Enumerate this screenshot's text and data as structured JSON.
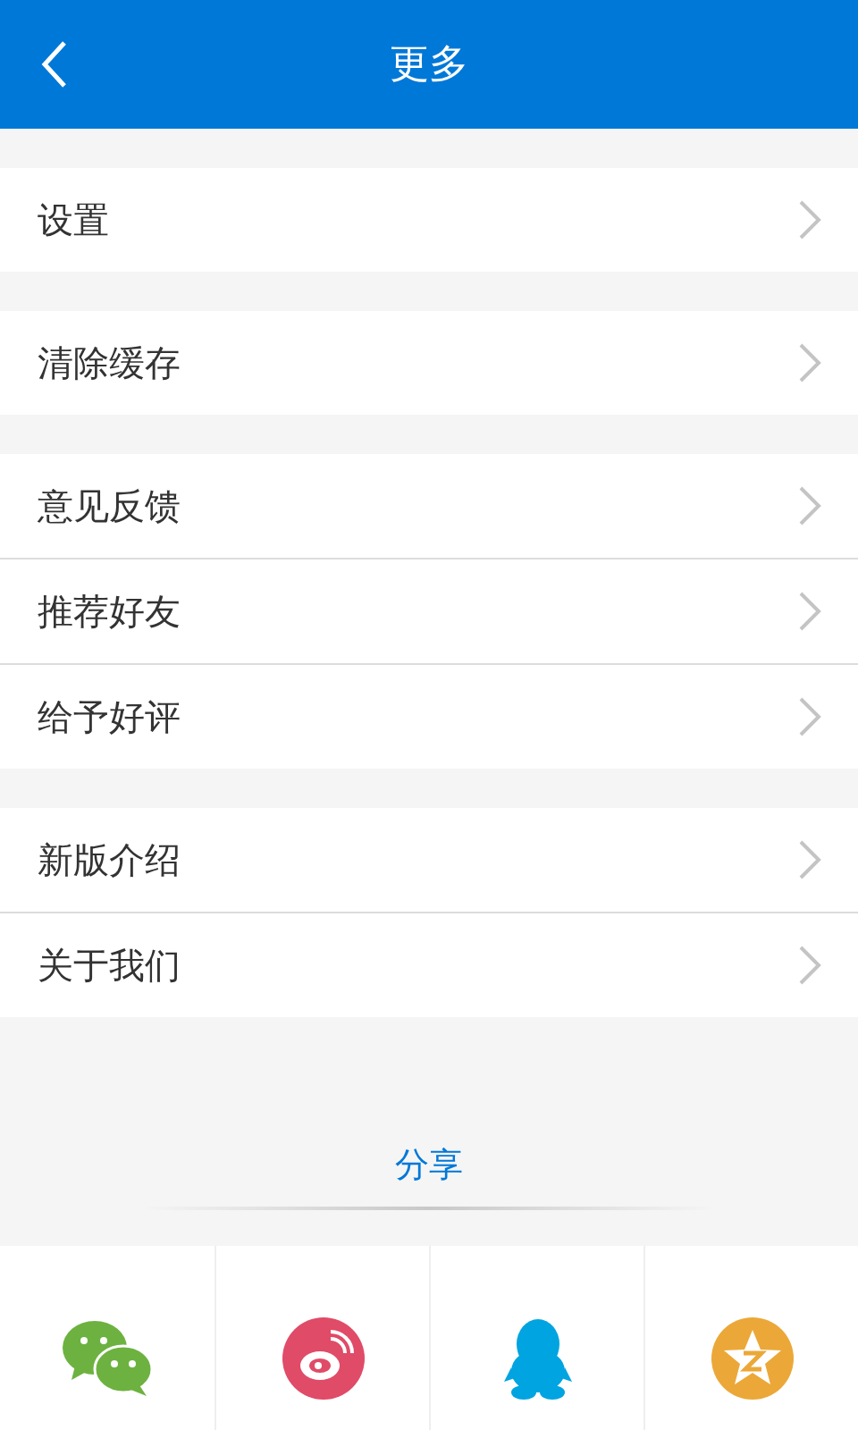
{
  "header": {
    "title": "更多"
  },
  "groups": [
    {
      "items": [
        {
          "label": "设置"
        }
      ]
    },
    {
      "items": [
        {
          "label": "清除缓存"
        }
      ]
    },
    {
      "items": [
        {
          "label": "意见反馈"
        },
        {
          "label": "推荐好友"
        },
        {
          "label": "给予好评"
        }
      ]
    },
    {
      "items": [
        {
          "label": "新版介绍"
        },
        {
          "label": "关于我们"
        }
      ]
    }
  ],
  "share": {
    "label": "分享",
    "targets": [
      {
        "kind": "chat"
      },
      {
        "kind": "weibo"
      },
      {
        "kind": "penguin"
      },
      {
        "kind": "star"
      }
    ]
  }
}
